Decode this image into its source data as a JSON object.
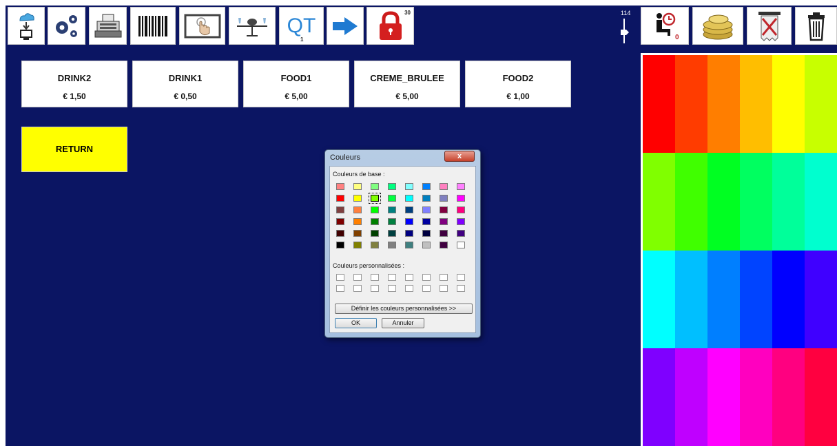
{
  "toolbar": {
    "qt_label": "QT",
    "qt_badge": "1",
    "lock_badge": "30",
    "seat_badge": "0",
    "counter": "114"
  },
  "products": [
    {
      "name": "DRINK2",
      "price": "€ 1,50"
    },
    {
      "name": "DRINK1",
      "price": "€ 0,50"
    },
    {
      "name": "FOOD1",
      "price": "€ 5,00"
    },
    {
      "name": "CREME_BRULEE",
      "price": "€ 5,00"
    },
    {
      "name": "FOOD2",
      "price": "€ 1,00"
    }
  ],
  "return_label": "RETURN",
  "palette": {
    "rows": [
      [
        "#ff0000",
        "#ff3c00",
        "#ff7e00",
        "#ffbe00",
        "#ffff00",
        "#c8ff00"
      ],
      [
        "#80ff00",
        "#40ff00",
        "#00ff22",
        "#00ff60",
        "#00ff9a",
        "#00ffcf"
      ],
      [
        "#00ffff",
        "#00bfff",
        "#007fff",
        "#0044ff",
        "#0000ff",
        "#3f00ff"
      ],
      [
        "#7f00ff",
        "#bf00ff",
        "#ff00ff",
        "#ff00bf",
        "#ff0080",
        "#ff0040"
      ]
    ]
  },
  "dialog": {
    "title": "Couleurs",
    "close": "x",
    "basic_label": "Couleurs de base :",
    "basic_colors": [
      [
        "#ff8080",
        "#ffff80",
        "#80ff80",
        "#00ff80",
        "#80ffff",
        "#0080ff",
        "#ff80c0",
        "#ff80ff"
      ],
      [
        "#ff0000",
        "#ffff00",
        "#80ff00",
        "#00ff40",
        "#00ffff",
        "#0080c0",
        "#8080c0",
        "#ff00ff"
      ],
      [
        "#804040",
        "#ff8040",
        "#00ff00",
        "#008080",
        "#004080",
        "#8080ff",
        "#800040",
        "#ff0080"
      ],
      [
        "#800000",
        "#ff8000",
        "#008000",
        "#008040",
        "#0000ff",
        "#0000a0",
        "#800080",
        "#8000ff"
      ],
      [
        "#400000",
        "#804000",
        "#004000",
        "#004040",
        "#000080",
        "#000040",
        "#400040",
        "#400080"
      ],
      [
        "#000000",
        "#808000",
        "#808040",
        "#808080",
        "#408080",
        "#c0c0c0",
        "#400040",
        "#ffffff"
      ]
    ],
    "selected": [
      1,
      2
    ],
    "custom_label": "Couleurs personnalisées :",
    "define_label": "Définir les couleurs personnalisées >>",
    "ok_label": "OK",
    "cancel_label": "Annuler"
  }
}
